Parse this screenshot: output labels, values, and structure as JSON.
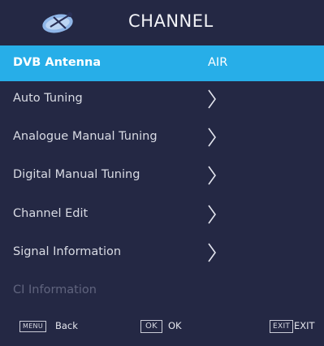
{
  "header": {
    "title": "CHANNEL",
    "icon": "satellite-dish-icon"
  },
  "colors": {
    "background": "#242844",
    "selected": "#27aee8",
    "disabled_text": "#60647e"
  },
  "menu": {
    "items": [
      {
        "label": "DVB Antenna",
        "value": "AIR",
        "selected": true
      },
      {
        "label": "Auto Tuning",
        "arrow": true
      },
      {
        "label": "Analogue Manual Tuning",
        "arrow": true
      },
      {
        "label": "Digital Manual Tuning",
        "arrow": true
      },
      {
        "label": "Channel Edit",
        "arrow": true
      },
      {
        "label": "Signal Information",
        "arrow": true
      },
      {
        "label": "CI Information",
        "disabled": true
      }
    ]
  },
  "footer": {
    "menu_key": "MENU",
    "menu_label": "Back",
    "ok_key": "OK",
    "ok_label": "OK",
    "exit_key": "EXIT",
    "exit_label": "EXIT"
  }
}
